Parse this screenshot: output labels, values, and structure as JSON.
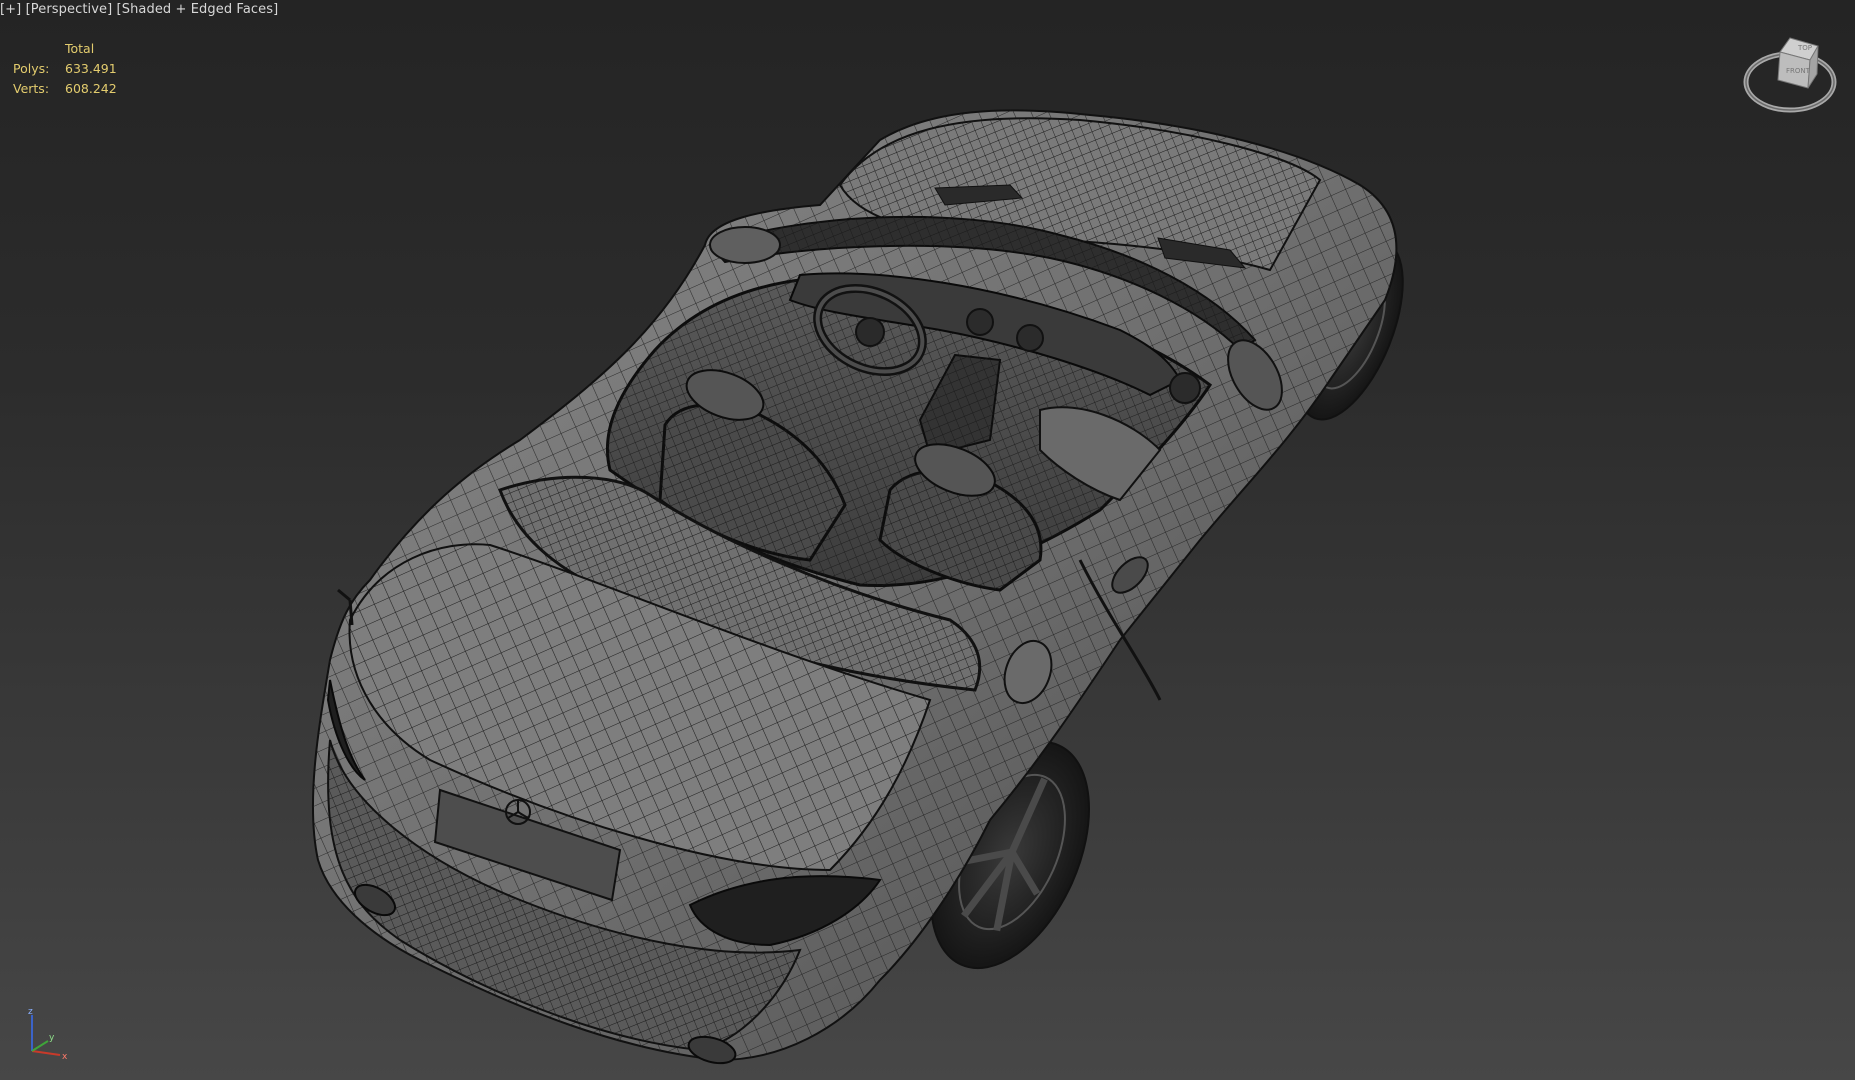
{
  "viewport": {
    "label": {
      "menu": "[+]",
      "view": "[Perspective]",
      "shading": "[Shaded + Edged Faces]"
    },
    "stats": {
      "header": "Total",
      "polys_label": "Polys:",
      "polys_value": "633.491",
      "verts_label": "Verts:",
      "verts_value": "608.242"
    },
    "viewcube": {
      "top_face": "TOP",
      "front_face": "FRONT"
    },
    "axis": {
      "x": "x",
      "y": "y",
      "z": "z"
    }
  },
  "colors": {
    "stats_text": "#e3cc6e",
    "label_text": "#d7d7d7",
    "mesh_fill": "#6b6b6b",
    "wire": "#1d1d1d",
    "axis_x": "#c83a2a",
    "axis_y": "#3fa53a",
    "axis_z": "#3b63c8"
  },
  "model": {
    "description_icon": "car-wireframe-model"
  }
}
